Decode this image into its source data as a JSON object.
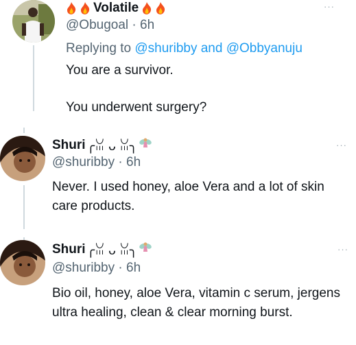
{
  "tweets": [
    {
      "display_name": "Volatile",
      "name_prefix_icons": [
        "fire-icon",
        "fire-icon"
      ],
      "name_suffix_icons": [
        "fire-icon",
        "fire-icon"
      ],
      "handle": "@Obugoal",
      "time": "· 6h",
      "reply_prefix": "Replying to",
      "reply_to": "@shuribby and @Obbyanuju",
      "lines": [
        "You are a survivor.",
        "You underwent surgery?"
      ],
      "more": "···"
    },
    {
      "display_name": "Shuri",
      "name_suffix_text": "╭ꈍ ᴗ ꈍ╮",
      "name_suffix_icon": "fairy-icon",
      "handle": "@shuribby",
      "time": "· 6h",
      "text": "Never. I used honey, aloe Vera and a lot of skin care products.",
      "more": "···"
    },
    {
      "display_name": "Shuri",
      "name_suffix_text": "╭ꈍ ᴗ ꈍ╮",
      "name_suffix_icon": "fairy-icon",
      "handle": "@shuribby",
      "time": "· 6h",
      "text": "Bio oil, honey, aloe Vera, vitamin c serum, jergens ultra healing, clean & clear morning burst.",
      "more": "···"
    }
  ],
  "colors": {
    "text": "#0f1419",
    "secondary": "#536471",
    "link": "#1d9bf0",
    "thread_line": "#cfd9de"
  }
}
